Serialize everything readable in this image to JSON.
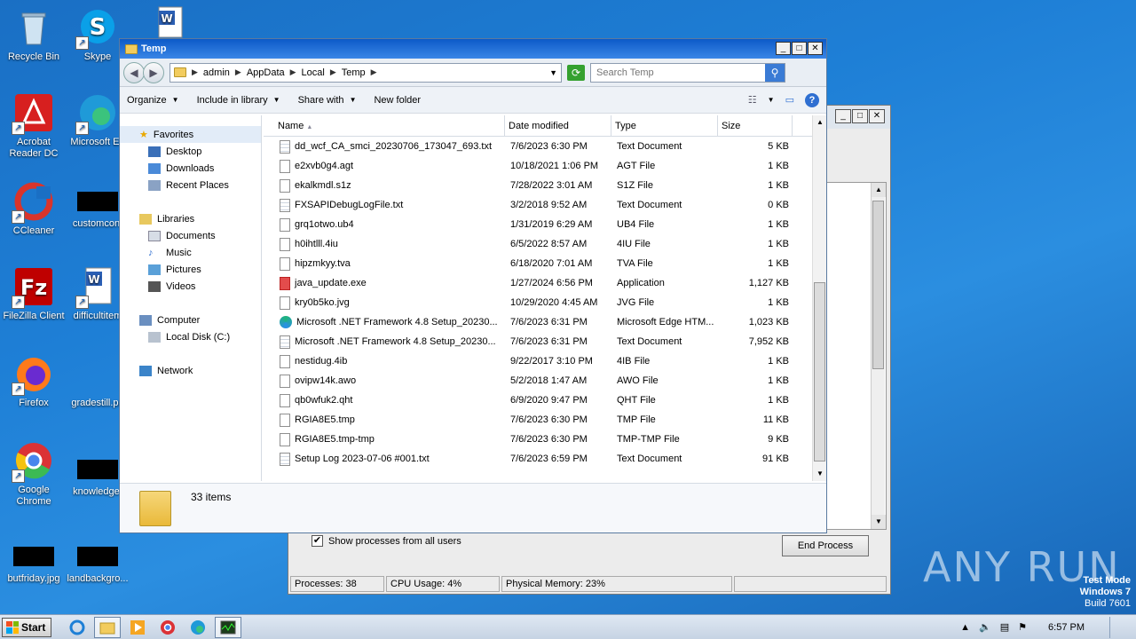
{
  "desktop": {
    "icons": [
      {
        "label": "Recycle Bin",
        "icon": "recycle-bin-icon"
      },
      {
        "label": "Skype",
        "icon": "skype-icon"
      },
      {
        "label": "Acrobat Reader DC",
        "icon": "acrobat-icon"
      },
      {
        "label": "Microsoft Ed",
        "icon": "edge-icon"
      },
      {
        "label": "CCleaner",
        "icon": "ccleaner-icon"
      },
      {
        "label": "customcont",
        "icon": "blackout-icon"
      },
      {
        "label": "FileZilla Client",
        "icon": "filezilla-icon"
      },
      {
        "label": "difficultitem",
        "icon": "word-doc-icon"
      },
      {
        "label": "Firefox",
        "icon": "firefox-icon"
      },
      {
        "label": "gradestill.pn",
        "icon": "file-icon"
      },
      {
        "label": "Google Chrome",
        "icon": "chrome-icon"
      },
      {
        "label": "knowledge.",
        "icon": "blackout-icon"
      },
      {
        "label": "butfriday.jpg",
        "icon": "blackout-icon"
      },
      {
        "label": "landbackgro...",
        "icon": "blackout-icon"
      }
    ]
  },
  "taskmgr": {
    "show_all_label": "Show processes from all users",
    "end_process_label": "End Process",
    "status": {
      "processes": "Processes: 38",
      "cpu": "CPU Usage: 4%",
      "memory": "Physical Memory: 23%"
    }
  },
  "explorer": {
    "title": "Temp",
    "breadcrumb": [
      "admin",
      "AppData",
      "Local",
      "Temp"
    ],
    "search_placeholder": "Search Temp",
    "toolbar": {
      "organize": "Organize",
      "include": "Include in library",
      "share": "Share with",
      "newfolder": "New folder"
    },
    "nav": {
      "favorites": "Favorites",
      "desktop": "Desktop",
      "downloads": "Downloads",
      "recent": "Recent Places",
      "libraries": "Libraries",
      "documents": "Documents",
      "music": "Music",
      "pictures": "Pictures",
      "videos": "Videos",
      "computer": "Computer",
      "localdisk": "Local Disk (C:)",
      "network": "Network"
    },
    "columns": {
      "name": "Name",
      "date": "Date modified",
      "type": "Type",
      "size": "Size"
    },
    "files": [
      {
        "name": "dd_wcf_CA_smci_20230706_173047_693.txt",
        "date": "7/6/2023 6:30 PM",
        "type": "Text Document",
        "size": "5 KB",
        "icon": "text-file-icon"
      },
      {
        "name": "e2xvb0g4.agt",
        "date": "10/18/2021 1:06 PM",
        "type": "AGT File",
        "size": "1 KB",
        "icon": "file-icon"
      },
      {
        "name": "ekalkmdl.s1z",
        "date": "7/28/2022 3:01 AM",
        "type": "S1Z File",
        "size": "1 KB",
        "icon": "file-icon"
      },
      {
        "name": "FXSAPIDebugLogFile.txt",
        "date": "3/2/2018 9:52 AM",
        "type": "Text Document",
        "size": "0 KB",
        "icon": "text-file-icon"
      },
      {
        "name": "grq1otwo.ub4",
        "date": "1/31/2019 6:29 AM",
        "type": "UB4 File",
        "size": "1 KB",
        "icon": "file-icon"
      },
      {
        "name": "h0ihtlll.4iu",
        "date": "6/5/2022 8:57 AM",
        "type": "4IU File",
        "size": "1 KB",
        "icon": "file-icon"
      },
      {
        "name": "hipzmkyy.tva",
        "date": "6/18/2020 7:01 AM",
        "type": "TVA File",
        "size": "1 KB",
        "icon": "file-icon"
      },
      {
        "name": "java_update.exe",
        "date": "1/27/2024 6:56 PM",
        "type": "Application",
        "size": "1,127 KB",
        "icon": "exe-icon"
      },
      {
        "name": "kry0b5ko.jvg",
        "date": "10/29/2020 4:45 AM",
        "type": "JVG File",
        "size": "1 KB",
        "icon": "file-icon"
      },
      {
        "name": "Microsoft .NET Framework 4.8 Setup_20230...",
        "date": "7/6/2023 6:31 PM",
        "type": "Microsoft Edge HTM...",
        "size": "1,023 KB",
        "icon": "edge-file-icon"
      },
      {
        "name": "Microsoft .NET Framework 4.8 Setup_20230...",
        "date": "7/6/2023 6:31 PM",
        "type": "Text Document",
        "size": "7,952 KB",
        "icon": "text-file-icon"
      },
      {
        "name": "nestidug.4ib",
        "date": "9/22/2017 3:10 PM",
        "type": "4IB File",
        "size": "1 KB",
        "icon": "file-icon"
      },
      {
        "name": "ovipw14k.awo",
        "date": "5/2/2018 1:47 AM",
        "type": "AWO File",
        "size": "1 KB",
        "icon": "file-icon"
      },
      {
        "name": "qb0wfuk2.qht",
        "date": "6/9/2020 9:47 PM",
        "type": "QHT File",
        "size": "1 KB",
        "icon": "file-icon"
      },
      {
        "name": "RGIA8E5.tmp",
        "date": "7/6/2023 6:30 PM",
        "type": "TMP File",
        "size": "11 KB",
        "icon": "file-icon"
      },
      {
        "name": "RGIA8E5.tmp-tmp",
        "date": "7/6/2023 6:30 PM",
        "type": "TMP-TMP File",
        "size": "9 KB",
        "icon": "file-icon"
      },
      {
        "name": "Setup Log 2023-07-06 #001.txt",
        "date": "7/6/2023 6:59 PM",
        "type": "Text Document",
        "size": "91 KB",
        "icon": "text-file-icon"
      }
    ],
    "item_count": "33 items"
  },
  "watermark": "ANY RUN",
  "testmode": {
    "line1": "Test Mode",
    "line2": "Windows 7",
    "line3": "Build 7601"
  },
  "taskbar": {
    "start": "Start",
    "clock": "6:57 PM"
  }
}
